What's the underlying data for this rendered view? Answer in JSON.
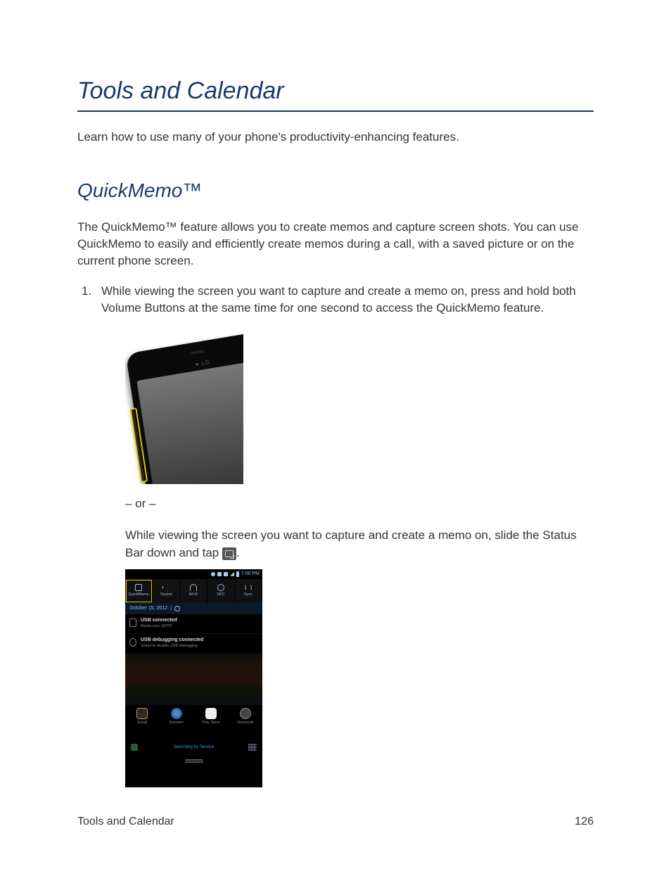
{
  "chapter_title": "Tools and Calendar",
  "intro": "Learn how to use many of your phone's productivity-enhancing features.",
  "section_title": "QuickMemo™",
  "section_intro": "The QuickMemo™ feature allows you to create memos and capture screen shots. You can use QuickMemo to easily and efficiently create memos during a call, with a saved picture or on the current phone screen.",
  "step1": "While viewing the screen you want to capture and create a memo on, press and hold both Volume Buttons at the same time for one second to access the QuickMemo feature.",
  "phone_logo": "● LG",
  "or_text": "– or –",
  "alt_text_part1": "While viewing the screen you want to capture and create a memo on, slide the Status Bar down and tap ",
  "alt_text_part2": ".",
  "panel": {
    "time": "7:00 PM",
    "quick_items": [
      "QuickMemo",
      "Sound",
      "Wi-Fi",
      "NFC",
      "Sync"
    ],
    "date": "October 15, 2012",
    "notif1_title": "USB connected",
    "notif1_sub": "Media sync (MTP)",
    "notif2_title": "USB debugging connected",
    "notif2_sub": "Select to disable USB debugging.",
    "dock": [
      "Email",
      "Browser",
      "Play Store",
      "Voicemail"
    ],
    "search_text": "Searching for Service"
  },
  "footer_left": "Tools and Calendar",
  "footer_right": "126"
}
